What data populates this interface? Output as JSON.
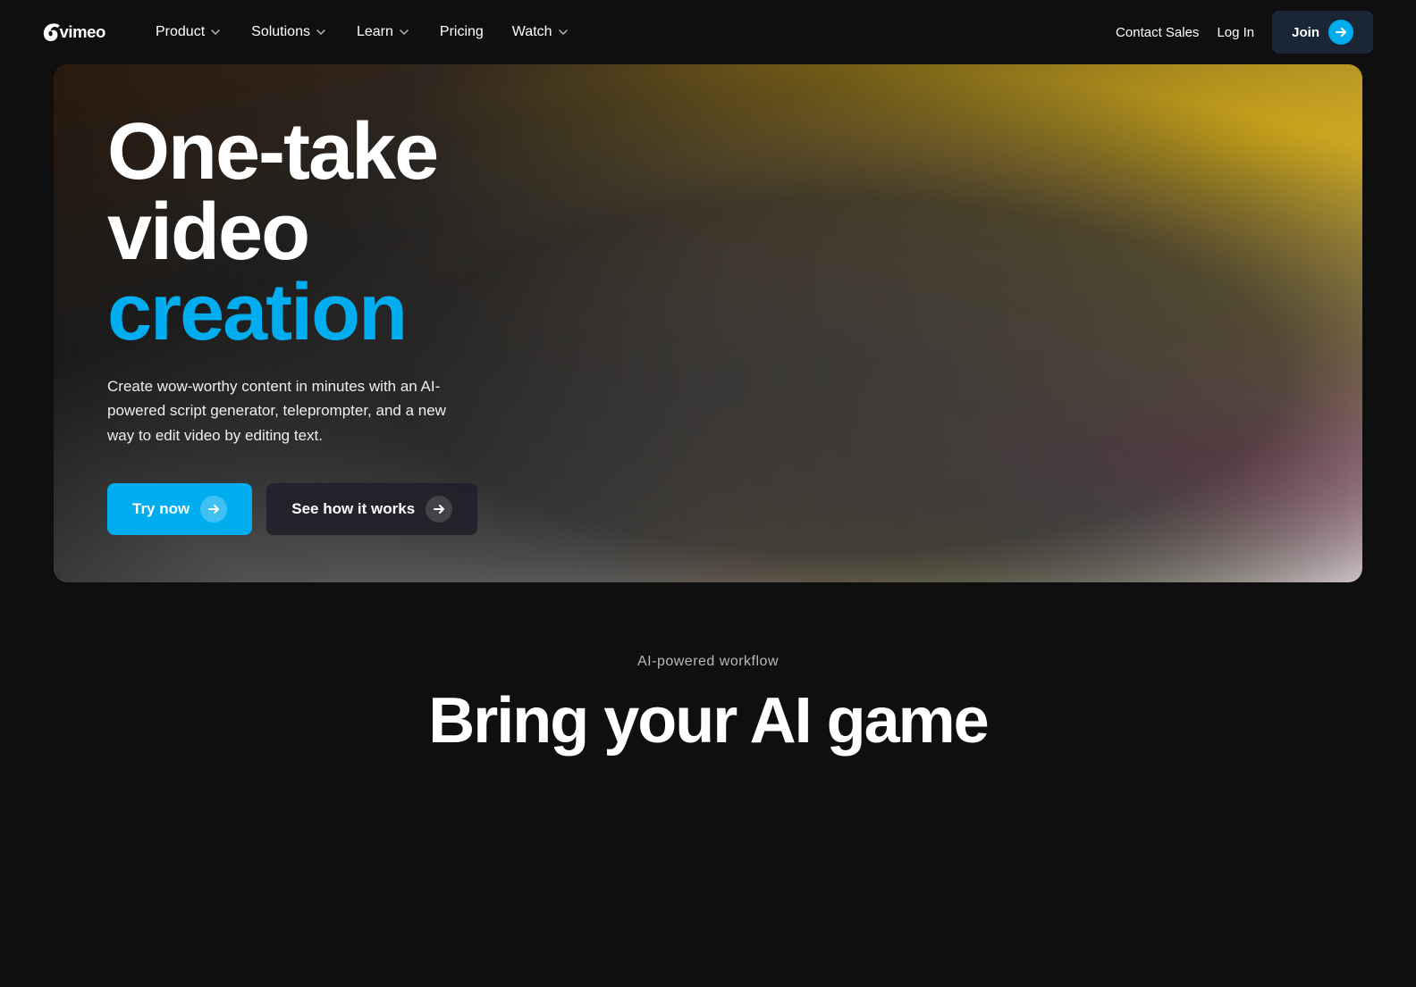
{
  "brand": {
    "name": "Vimeo"
  },
  "navbar": {
    "logo_text": "vimeo",
    "items": [
      {
        "label": "Product",
        "has_dropdown": true
      },
      {
        "label": "Solutions",
        "has_dropdown": true
      },
      {
        "label": "Learn",
        "has_dropdown": true
      },
      {
        "label": "Pricing",
        "has_dropdown": false
      },
      {
        "label": "Watch",
        "has_dropdown": true
      }
    ],
    "contact_sales": "Contact Sales",
    "login": "Log In",
    "join": "Join"
  },
  "hero": {
    "title_line1": "One-take",
    "title_line2": "video",
    "title_line3": "creation",
    "subtitle": "Create wow-worthy content in minutes with an AI-powered script generator, teleprompter, and a new way to edit video by editing text.",
    "btn_try_now": "Try now",
    "btn_see_how": "See how it works"
  },
  "below_hero": {
    "ai_label": "AI-powered workflow",
    "bring_title": "Bring your AI game"
  }
}
